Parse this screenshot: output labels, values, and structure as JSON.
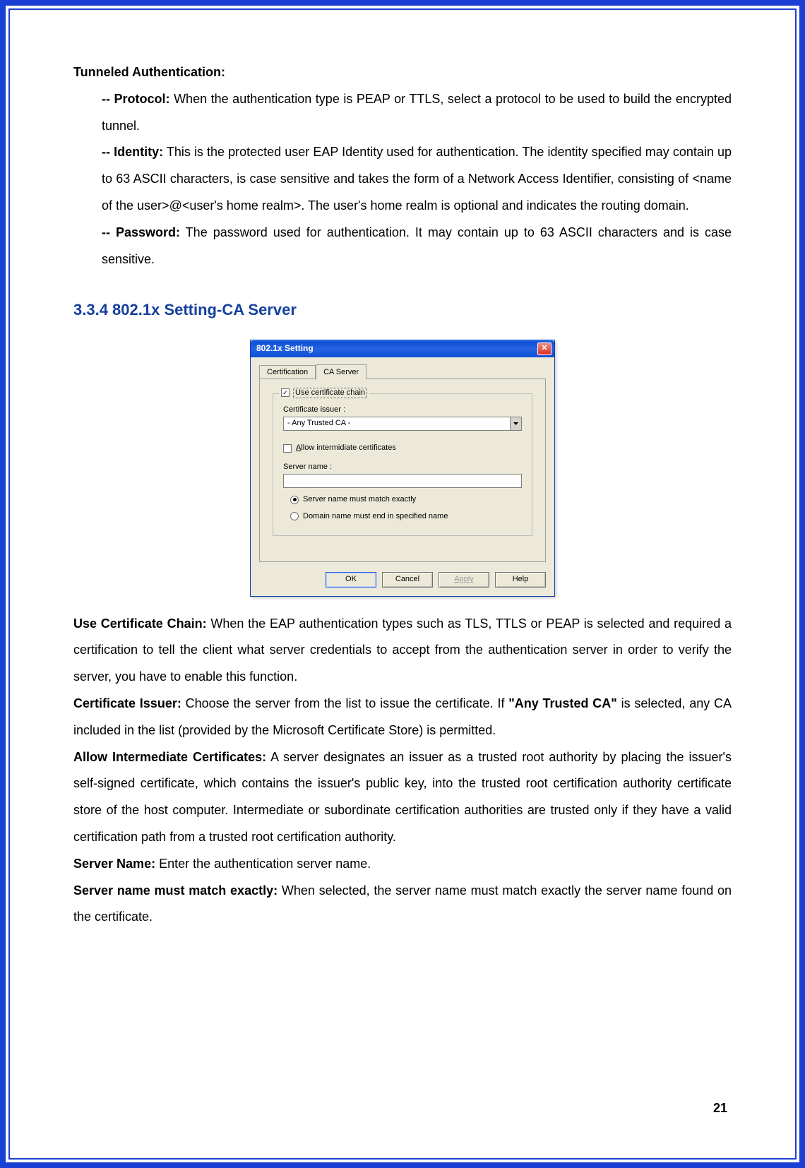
{
  "page_number": "21",
  "section1": {
    "heading": "Tunneled Authentication:",
    "protocol_label": "-- Protocol:",
    "protocol_text": " When the authentication type is PEAP or TTLS, select a protocol to be used to build the encrypted tunnel.",
    "identity_label": "-- Identity:",
    "identity_text": " This is the protected user EAP Identity used for authentication. The identity specified may contain up to 63 ASCII characters, is case sensitive and takes the form of a Network Access Identifier, consisting of <name of the user>@<user's home realm>. The user's home realm is optional and indicates the routing domain.",
    "password_label": "-- Password:",
    "password_text": " The password used for authentication. It may contain up to 63 ASCII characters and is case sensitive."
  },
  "section2_heading": "3.3.4 802.1x Setting-CA Server",
  "dialog": {
    "title": "802.1x Setting",
    "tab1": "Certification",
    "tab2": "CA Server",
    "use_cert_chain_label": "Use certificate chain",
    "cert_issuer_label": "Certificate issuer :",
    "cert_issuer_value": "- Any Trusted CA -",
    "allow_intermediate_label": "Allow intermidiate certificates",
    "server_name_label": "Server name :",
    "radio_match_exactly": "Server name must match exactly",
    "radio_domain_end": "Domain name must end in specified name",
    "ok": "OK",
    "cancel": "Cancel",
    "apply": "Apply",
    "help": "Help"
  },
  "body": {
    "use_cert_chain_label": "Use Certificate Chain:",
    "use_cert_chain_text": " When the EAP authentication types such as TLS, TTLS or PEAP is selected and required a certification to tell the client what server credentials to accept from the authentication server in order to verify the server, you have to enable this function.",
    "cert_issuer_label": "Certificate Issuer:",
    "cert_issuer_text_a": " Choose the server from the list to issue the certificate. If ",
    "cert_issuer_bold": "\"Any Trusted CA\"",
    "cert_issuer_text_b": " is selected, any CA included in the list (provided by the Microsoft Certificate Store) is permitted.",
    "allow_intermediate_label": "Allow Intermediate Certificates:",
    "allow_intermediate_text": " A server designates an issuer as a trusted root authority by placing the issuer's self-signed certificate, which contains the issuer's public key, into the trusted root certification authority certificate store of the host computer. Intermediate or subordinate certification authorities are trusted only if they have a valid certification path from a trusted root certification authority.",
    "server_name_label": "Server Name:",
    "server_name_text": " Enter the authentication server name.",
    "server_match_label": "Server name must match exactly:",
    "server_match_text": " When selected, the server name must match exactly the server name found on the certificate."
  }
}
